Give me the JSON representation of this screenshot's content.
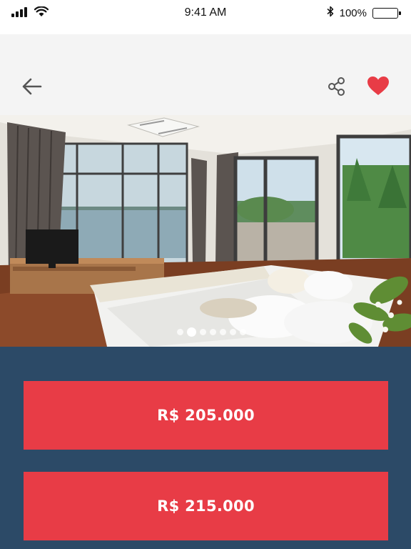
{
  "status_bar": {
    "time": "9:41 AM",
    "battery": "100%",
    "icons": [
      "signal-icon",
      "wifi-icon",
      "bluetooth-icon",
      "battery-icon"
    ]
  },
  "nav": {
    "icons": [
      "back-arrow-icon",
      "share-icon",
      "heart-icon"
    ],
    "favorite_color": "#e83c46"
  },
  "gallery": {
    "image_count": 7,
    "active_index": 1
  },
  "prices": [
    {
      "label": "R$ 205.000"
    },
    {
      "label": "R$ 215.000"
    }
  ],
  "colors": {
    "price_background": "#2c4a67",
    "price_button": "#e83c46",
    "nav_background": "#f4f4f4"
  }
}
